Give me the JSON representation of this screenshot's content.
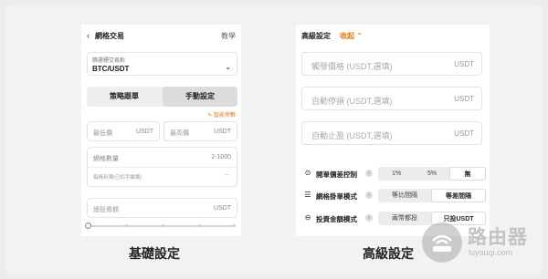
{
  "left_panel": {
    "back_glyph": "‹",
    "title": "網格交易",
    "tutorial": "教學",
    "pair_label": "篩選標交易對",
    "pair_value": "BTC/USDT",
    "tabs": [
      "策略跟單",
      "手動設定"
    ],
    "active_tab": 1,
    "smart_params": "智能參數",
    "min_price_placeholder": "最低價",
    "max_price_placeholder": "最高價",
    "unit": "USDT",
    "grid_count_label": "網格數量",
    "grid_count_range": "2-1000",
    "grid_profit_label": "每格利潤(已扣手續費)",
    "grid_profit_value": "--",
    "invest_placeholder": "總投資額",
    "caption": "基礎設定"
  },
  "right_panel": {
    "title": "高級設定",
    "collapse": "收起",
    "fields": [
      {
        "placeholder": "觸發價格 (USDT,選填)",
        "unit": "USDT"
      },
      {
        "placeholder": "自動停損 (USDT,選填)",
        "unit": "USDT"
      },
      {
        "placeholder": "自動止盈 (USDT,選填)",
        "unit": "USDT"
      }
    ],
    "options": [
      {
        "label": "開單價差控制",
        "choices": [
          "1%",
          "5%",
          "無"
        ],
        "selected": 2
      },
      {
        "label": "網格掛單模式",
        "choices": [
          "等比間隔",
          "等差間隔"
        ],
        "selected": 1
      },
      {
        "label": "投資金額模式",
        "choices": [
          "兩幣都投",
          "只投USDT"
        ],
        "selected": 1
      }
    ],
    "caption": "高級設定"
  },
  "watermark": {
    "name": "路由器",
    "url": "luyouqi.com"
  },
  "colors": {
    "accent": "#e07a1f",
    "background": "#ececec",
    "panel": "#ffffff"
  }
}
